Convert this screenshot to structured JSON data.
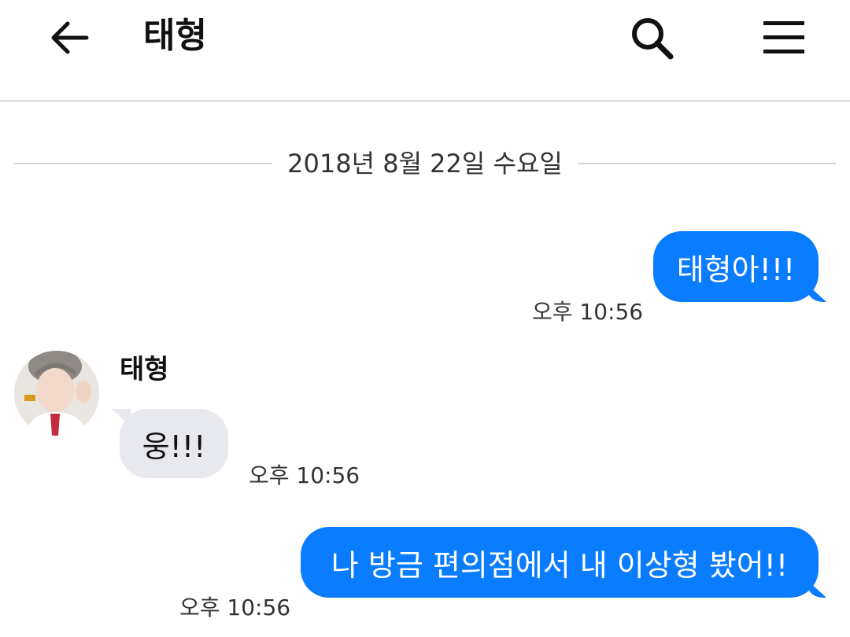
{
  "header": {
    "title": "태형",
    "back_icon": "back-arrow-icon",
    "search_icon": "search-icon",
    "menu_icon": "hamburger-menu-icon"
  },
  "date_divider": {
    "text": "2018년 8월 22일 수요일"
  },
  "messages": [
    {
      "direction": "sent",
      "text": "태형아!!!",
      "time": "오후 10:56"
    },
    {
      "direction": "received",
      "sender": "태형",
      "text": "웅!!!",
      "time": "오후 10:56"
    },
    {
      "direction": "sent",
      "text": "나 방금 편의점에서 내 이상형 봤어!!",
      "time": "오후 10:56"
    }
  ],
  "colors": {
    "sent_bubble": "#0a7cff",
    "received_bubble": "#e8e9ee",
    "divider": "#d4d4d4"
  }
}
